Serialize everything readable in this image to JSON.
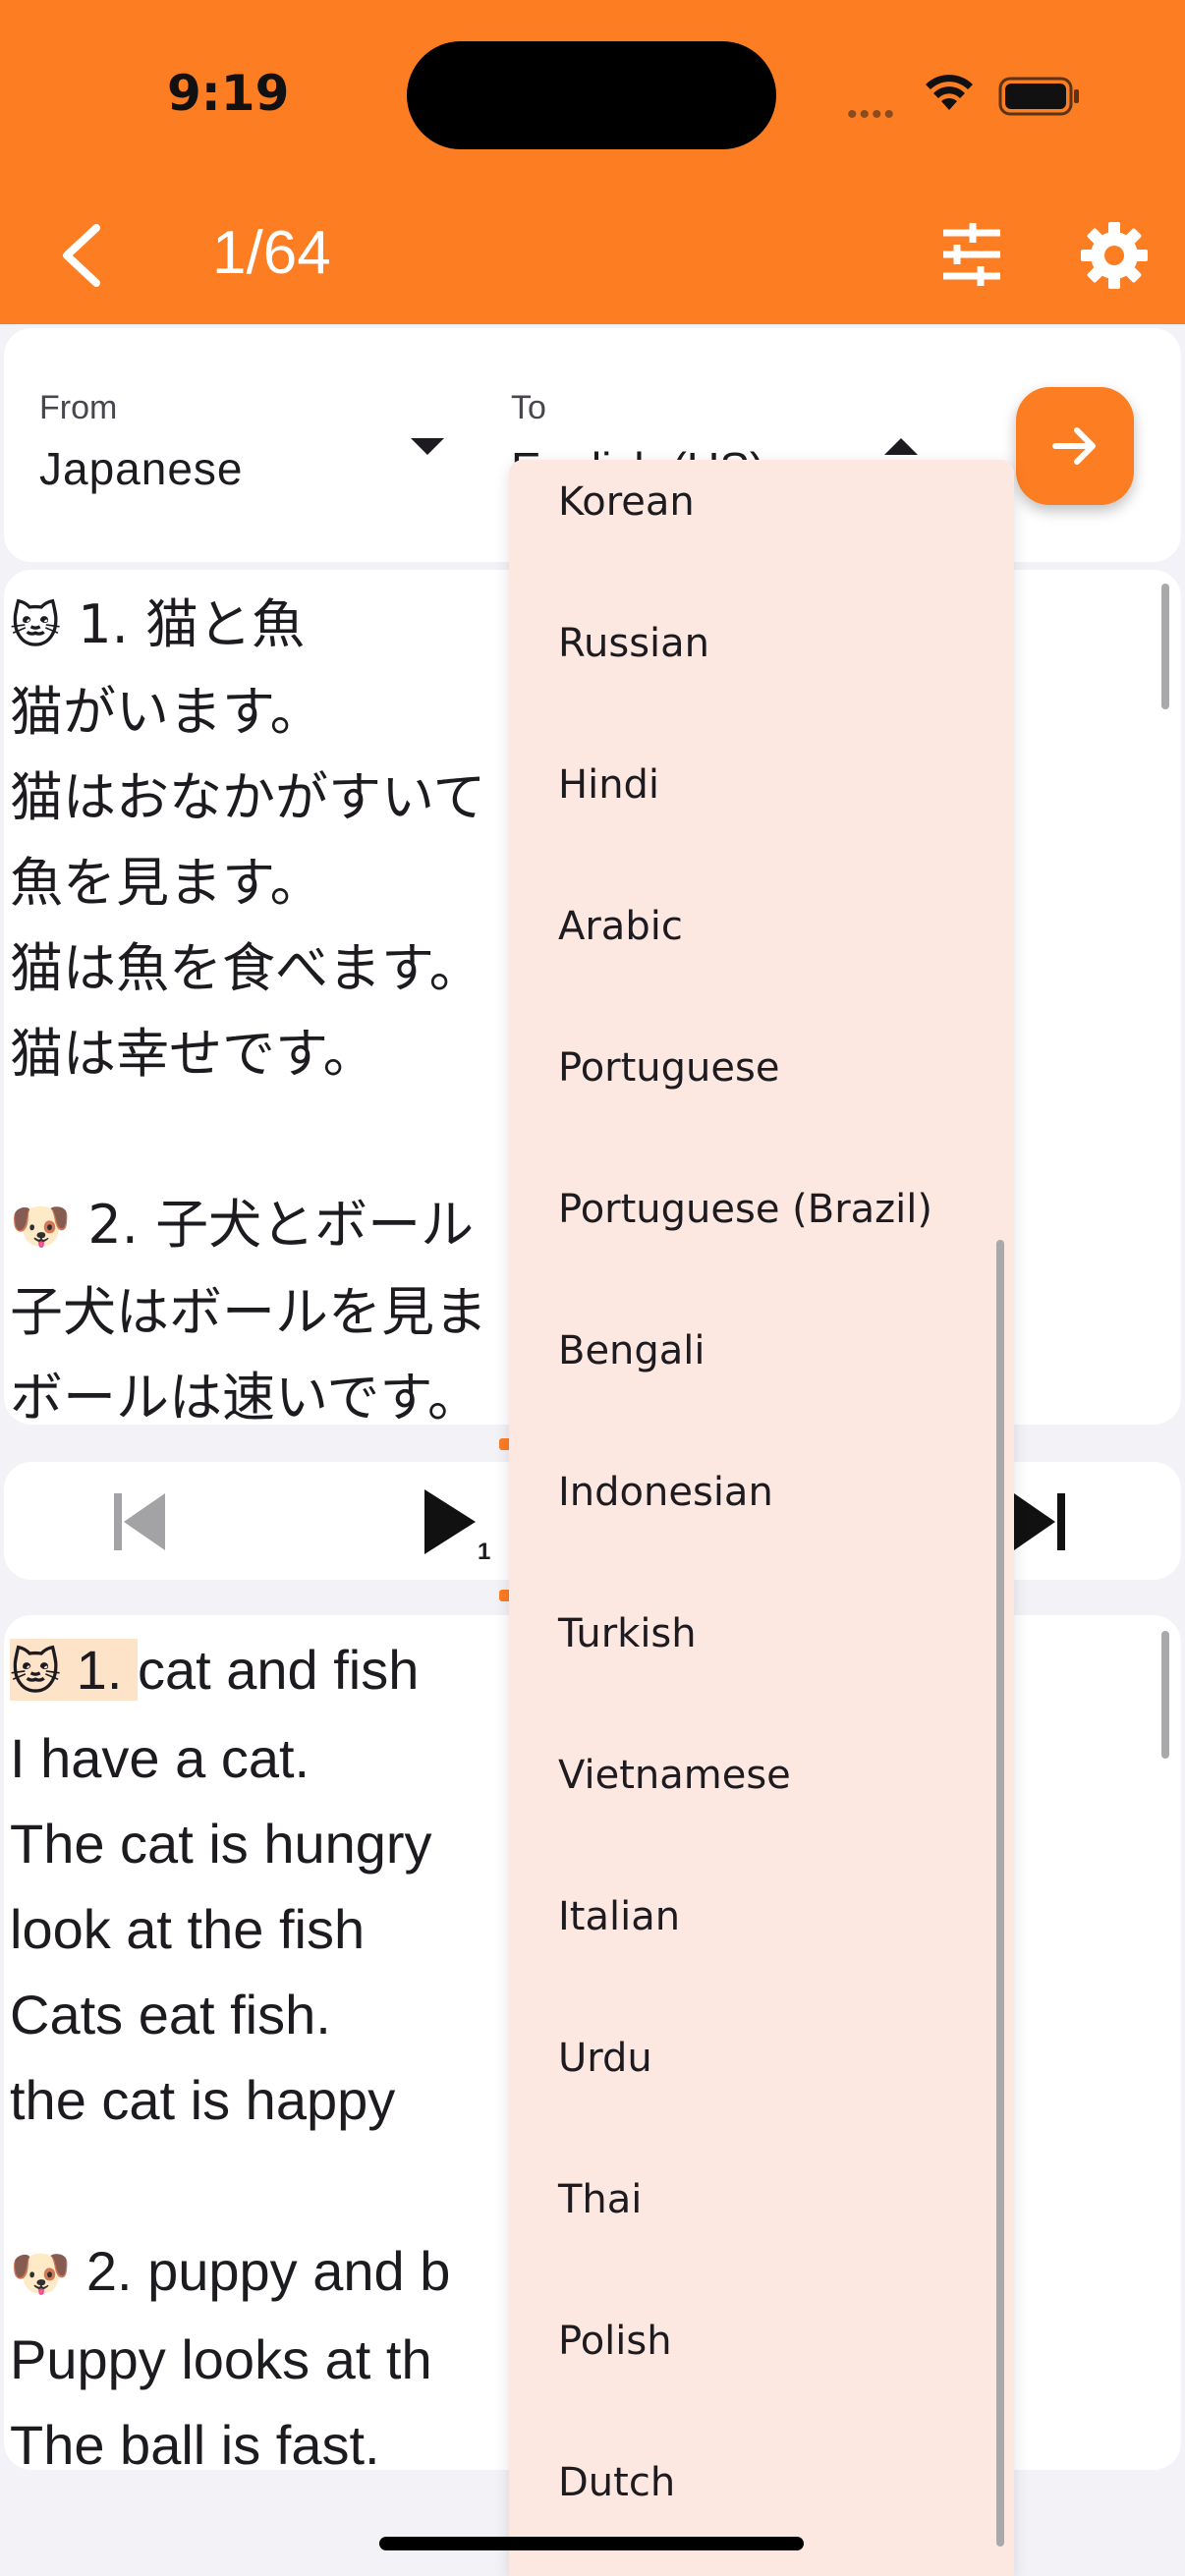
{
  "status_bar": {
    "time": "9:19",
    "dots": "••••"
  },
  "header": {
    "page_counter": "1/64",
    "back_icon": "chevron-left-icon",
    "tune_icon": "sliders-icon",
    "settings_icon": "gear-icon"
  },
  "languages": {
    "from_label": "From",
    "from_value": "Japanese",
    "to_label": "To",
    "to_value": "English (US)"
  },
  "source_text": {
    "lines": [
      {
        "emoji": "🐱",
        "text": " 1. 猫と魚"
      },
      {
        "text": "猫がいます。"
      },
      {
        "text": "猫はおなかがすいて"
      },
      {
        "text": "魚を見ます。"
      },
      {
        "text": "猫は魚を食べます。"
      },
      {
        "text": "猫は幸せです。"
      },
      {
        "text": ""
      },
      {
        "emoji": "🐶",
        "text": " 2. 子犬とボール"
      },
      {
        "text": "子犬はボールを見ま"
      },
      {
        "text": "ボールは速いです。"
      }
    ]
  },
  "player": {
    "play_count": "1",
    "prev_icon": "skip-previous-icon",
    "play_icon": "play-icon",
    "next_icon": "skip-next-icon"
  },
  "target_text": {
    "first_emoji": "🐱",
    "first_number": " 1. ",
    "first_title": "cat and fish",
    "lines": [
      "I have a cat.",
      "The cat is hungry",
      "look at the fish",
      "Cats eat fish.",
      "the cat is happy",
      ""
    ],
    "second_emoji": "🐶",
    "second_title": " 2. puppy and b",
    "more_lines": [
      "Puppy looks at th",
      "The ball is fast."
    ]
  },
  "dropdown": {
    "items": [
      "Korean",
      "Russian",
      "Hindi",
      "Arabic",
      "Portuguese",
      "Portuguese (Brazil)",
      "Bengali",
      "Indonesian",
      "Turkish",
      "Vietnamese",
      "Italian",
      "Urdu",
      "Thai",
      "Polish",
      "Dutch"
    ]
  },
  "colors": {
    "accent": "#fd7d23",
    "dropdown_bg": "#fce8e1",
    "highlight": "#fde3c8"
  }
}
